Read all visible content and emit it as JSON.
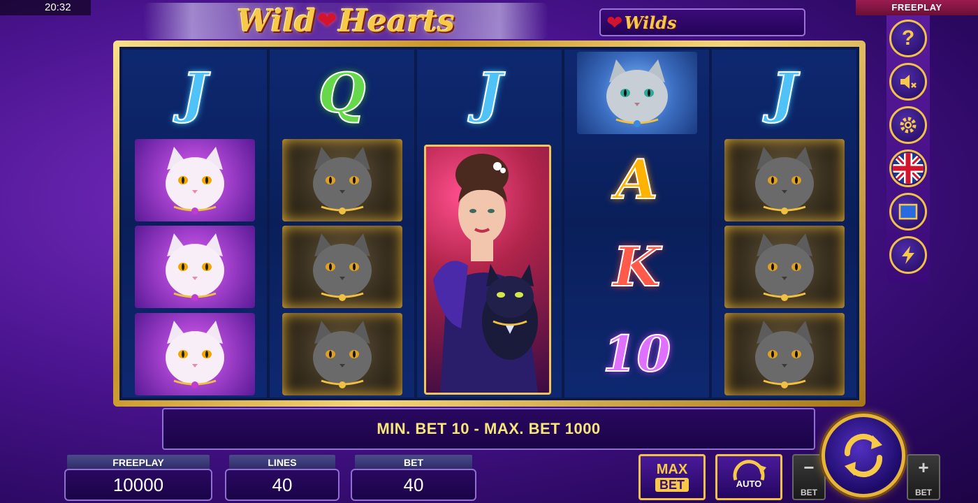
{
  "status_bar": {
    "time": "20:32",
    "mode": "FREEPLAY"
  },
  "logo": {
    "word1": "Wild",
    "word2": "Hearts"
  },
  "wilds_panel": {
    "label": "Wilds"
  },
  "reels": [
    [
      "J",
      "white-cat",
      "white-cat",
      "white-cat"
    ],
    [
      "Q",
      "grey-cat",
      "grey-cat",
      "grey-cat"
    ],
    [
      "J",
      "lady-with-cat"
    ],
    [
      "silver-cat",
      "A",
      "K",
      "10"
    ],
    [
      "J",
      "grey-cat",
      "grey-cat",
      "grey-cat"
    ]
  ],
  "reel_letters": {
    "r1_top": "J",
    "r2_top": "Q",
    "r3_top": "J",
    "r4_a": "A",
    "r4_k": "K",
    "r4_10": "10",
    "r5_top": "J"
  },
  "message": "MIN. BET 10 - MAX. BET 1000",
  "stats": {
    "freeplay_label": "FREEPLAY",
    "freeplay_value": "10000",
    "lines_label": "LINES",
    "lines_value": "40",
    "bet_label": "BET",
    "bet_value": "40"
  },
  "buttons": {
    "max_bet_top": "MAX",
    "max_bet_bottom": "BET",
    "auto": "AUTO",
    "bet_minus_sign": "−",
    "bet_minus_label": "BET",
    "bet_plus_sign": "+",
    "bet_plus_label": "BET"
  },
  "sidebar": {
    "help": "?",
    "icons": [
      "help-icon",
      "sound-muted-icon",
      "settings-icon",
      "language-uk-flag-icon",
      "fullscreen-icon",
      "turbo-lightning-icon"
    ]
  },
  "colors": {
    "gold": "#f2c14a",
    "purple_bg": "#4b1490",
    "reel_bg": "#0a1f5a"
  }
}
